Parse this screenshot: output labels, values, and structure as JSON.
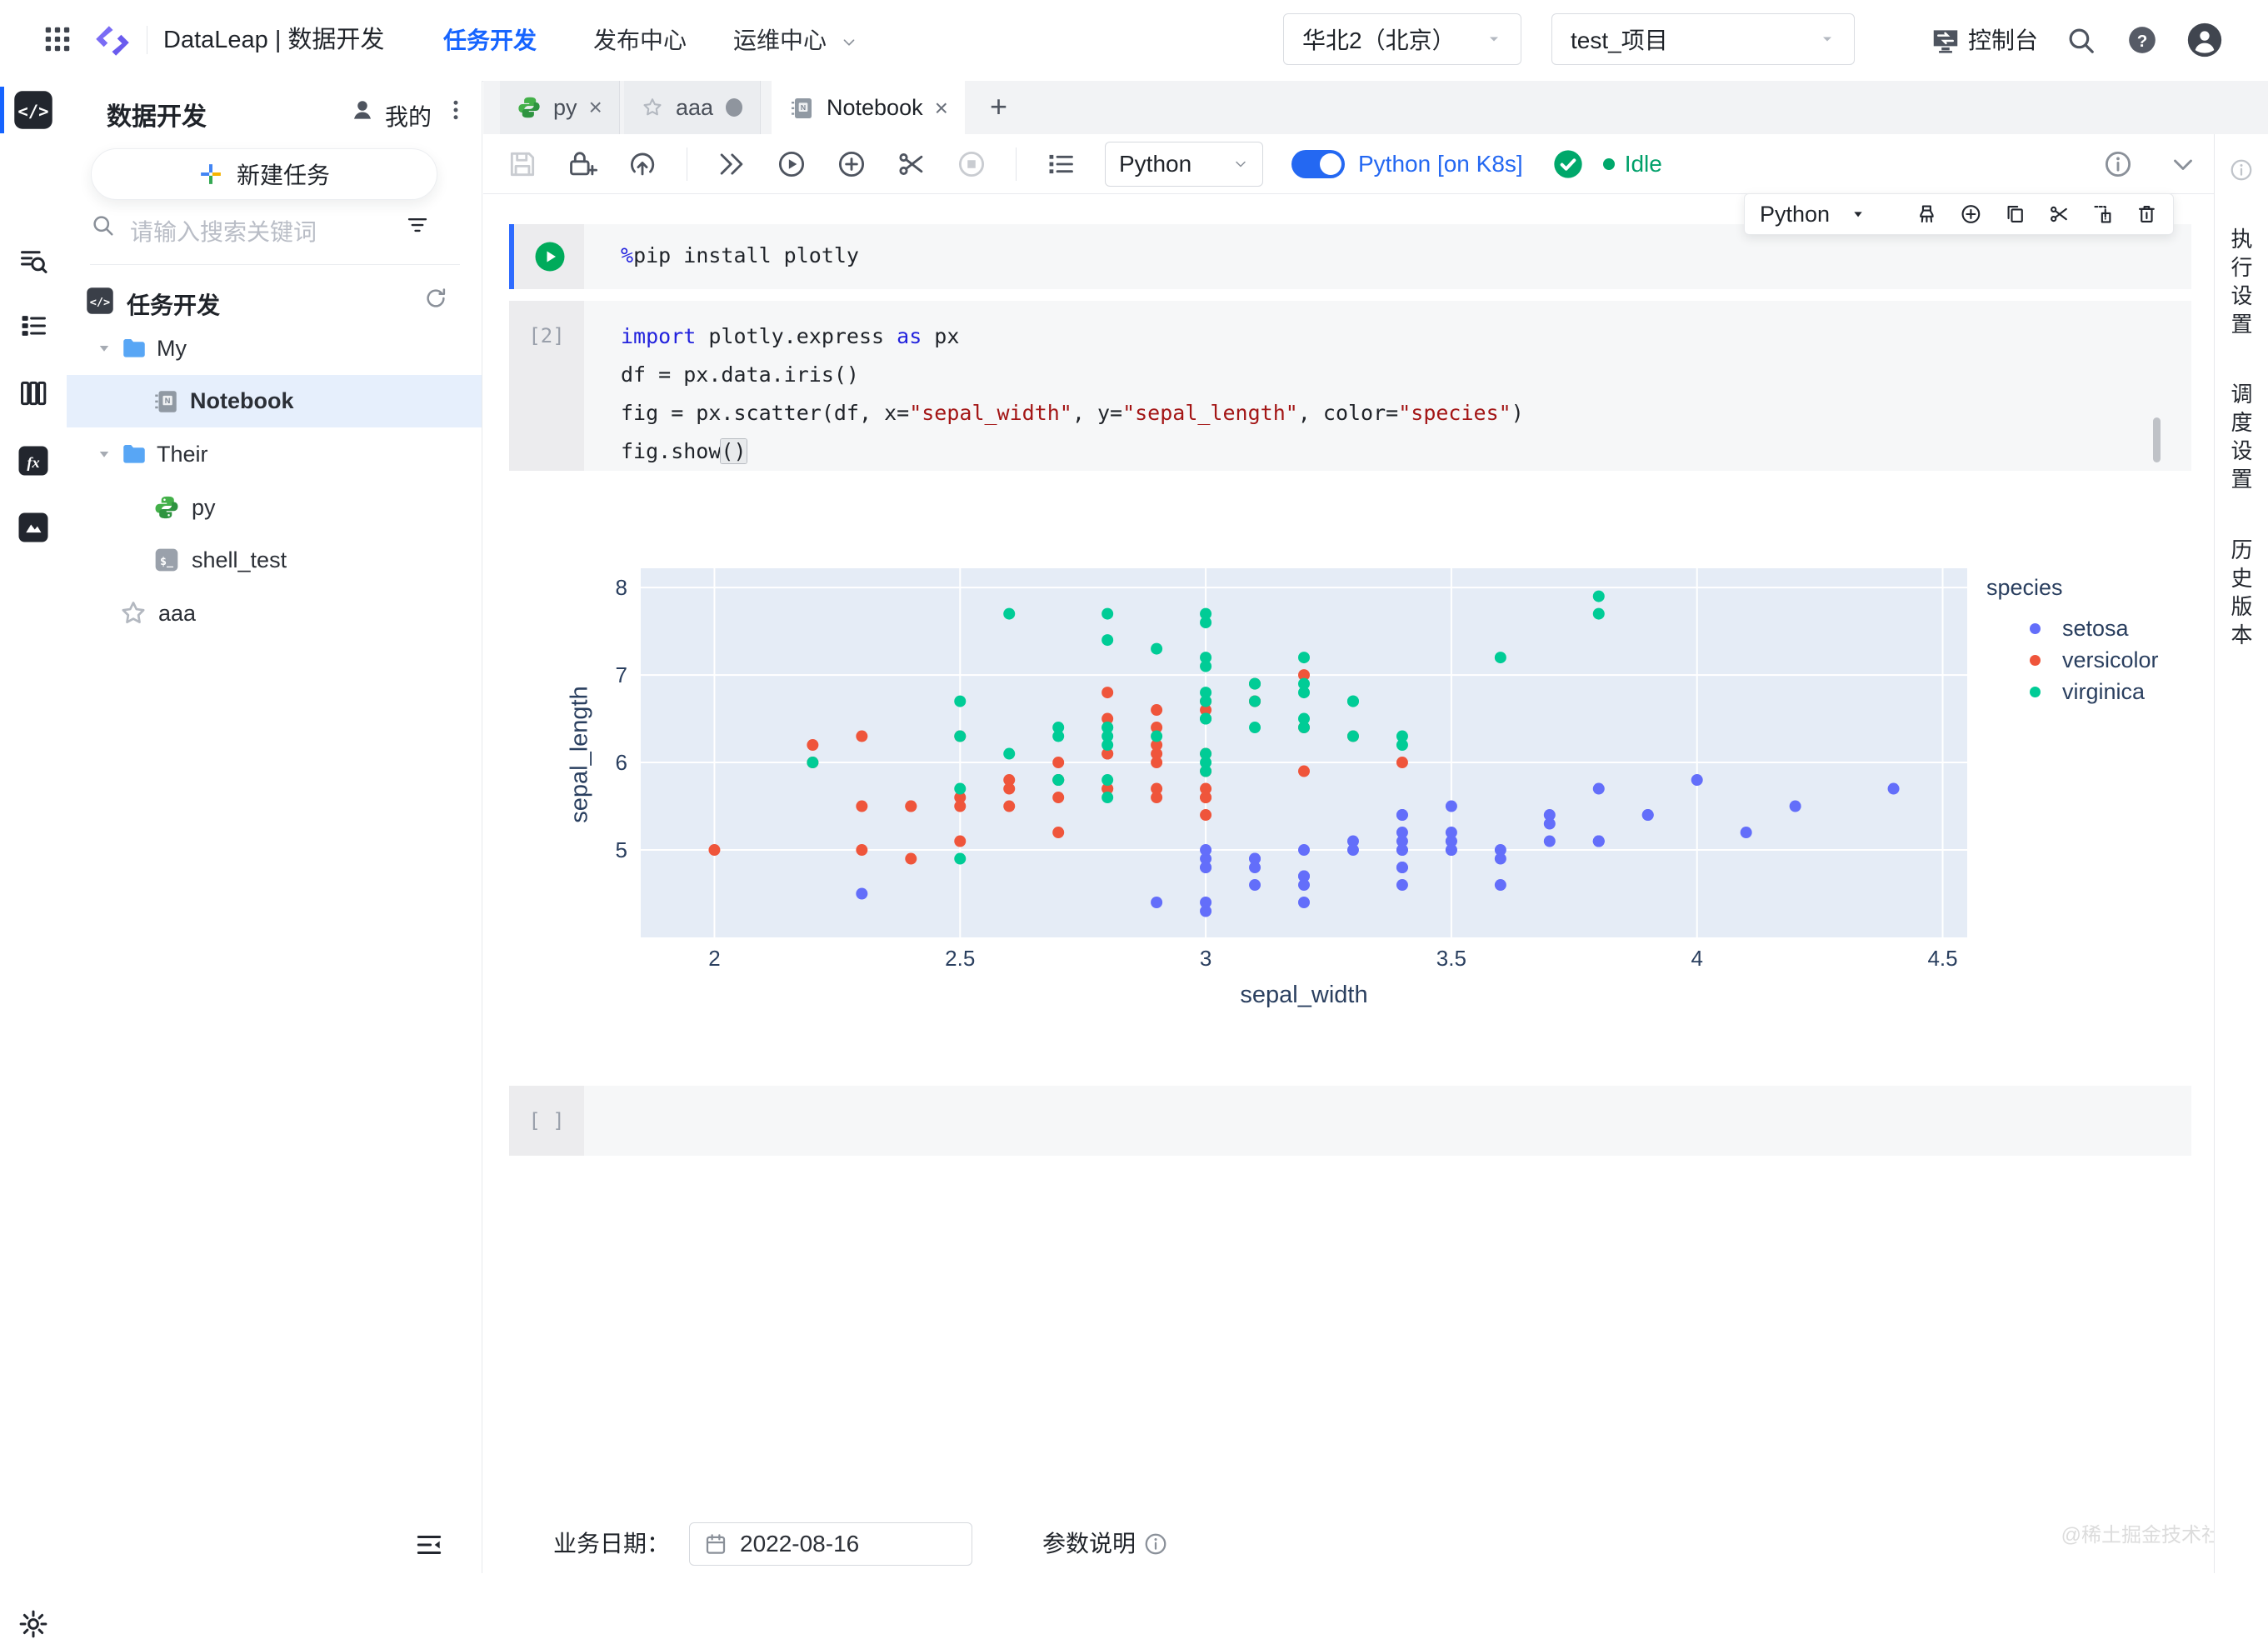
{
  "header": {
    "product_title": "DataLeap | 数据开发",
    "nav": [
      {
        "label": "任务开发",
        "active": true
      },
      {
        "label": "发布中心",
        "active": false
      },
      {
        "label": "运维中心",
        "active": false
      }
    ],
    "region_select": "华北2（北京）",
    "project_select": "test_项目",
    "console_label": "控制台",
    "icons": [
      "app-grid-icon",
      "dataleap-logo",
      "console-icon",
      "search-icon",
      "help-icon",
      "avatar"
    ]
  },
  "rail": {
    "items": [
      "code-editor",
      "data-search",
      "task-list",
      "data-catalog",
      "function-fx",
      "resource-library"
    ],
    "bottom": "settings-gear"
  },
  "sidebar": {
    "title": "数据开发",
    "mine_label": "我的",
    "new_task_label": "新建任务",
    "search_placeholder": "请输入搜索关键词",
    "tree_header": "任务开发",
    "tree": [
      {
        "label": "My",
        "type": "folder",
        "level": 1
      },
      {
        "label": "Notebook",
        "type": "notebook",
        "level": 2,
        "selected": true
      },
      {
        "label": "Their",
        "type": "folder",
        "level": 1
      },
      {
        "label": "py",
        "type": "python",
        "level": 2
      },
      {
        "label": "shell_test",
        "type": "shell",
        "level": 2
      },
      {
        "label": "aaa",
        "type": "starred",
        "level": 1
      }
    ]
  },
  "tabs": [
    {
      "label": "py",
      "icon": "python-icon",
      "close": "×",
      "dirty": false,
      "active": false
    },
    {
      "label": "aaa",
      "icon": "star-icon",
      "close": "",
      "dirty": true,
      "active": false
    },
    {
      "label": "Notebook",
      "icon": "notebook-icon",
      "close": "×",
      "dirty": false,
      "active": true
    }
  ],
  "new_tab_label": "+",
  "toolbar": {
    "icons": [
      "save",
      "lock-add",
      "submit",
      "run-all",
      "run-cell",
      "add-cell",
      "cut-cell",
      "interrupt",
      "outline"
    ],
    "kernel_select": "Python",
    "runtime_toggle_label": "Python [on K8s]",
    "kernel_ok": true,
    "status": "Idle",
    "right_icons": [
      "info",
      "chevron-down"
    ]
  },
  "cell_toolbar": {
    "kernel": "Python",
    "icons": [
      "clean",
      "add-cell",
      "duplicate",
      "cut",
      "paste",
      "delete"
    ]
  },
  "cells": {
    "cell1": {
      "lines": [
        [
          {
            "t": "%",
            "c": "kw"
          },
          {
            "t": "pip install plotly",
            "c": "pl"
          }
        ]
      ]
    },
    "cell2": {
      "exec": "[2]",
      "lines": [
        [
          {
            "t": "import",
            "c": "kw"
          },
          {
            "t": " plotly.express ",
            "c": "pl"
          },
          {
            "t": "as",
            "c": "kw"
          },
          {
            "t": " px",
            "c": "pl"
          }
        ],
        [
          {
            "t": "df = px.data.iris()",
            "c": "pl"
          }
        ],
        [
          {
            "t": "fig = px.scatter(df, x=",
            "c": "pl"
          },
          {
            "t": "\"sepal_width\"",
            "c": "str"
          },
          {
            "t": ", y=",
            "c": "pl"
          },
          {
            "t": "\"sepal_length\"",
            "c": "str"
          },
          {
            "t": ", color=",
            "c": "pl"
          },
          {
            "t": "\"species\"",
            "c": "str"
          },
          {
            "t": ")",
            "c": "pl"
          }
        ],
        [
          {
            "t": "fig.show",
            "c": "pl"
          },
          {
            "t": "()",
            "c": "br"
          }
        ]
      ]
    },
    "empty_cell": {
      "exec": "[ ]"
    }
  },
  "bottom_bar": {
    "date_label": "业务日期：",
    "date_value": "2022-08-16",
    "param_label": "参数说明"
  },
  "right_rail": [
    "执行设置",
    "调度设置",
    "历史版本"
  ],
  "watermark": "@稀土掘金技术社区",
  "colors": {
    "accent_blue": "#1664ff",
    "toggle_blue": "#2468f2",
    "status_green": "#00a86b",
    "plot_background": "#e5ecf6",
    "cell_play_green": "#00ab5b"
  },
  "chart_data": {
    "type": "scatter",
    "xlabel": "sepal_width",
    "ylabel": "sepal_length",
    "legend_title": "species",
    "legend_position": "right",
    "grid": "on",
    "plot_bg": "#e5ecf6",
    "xlim": [
      1.85,
      4.55
    ],
    "ylim": [
      4.0,
      8.22
    ],
    "xticks": [
      "2",
      "2.5",
      "3",
      "3.5",
      "4",
      "4.5"
    ],
    "xtick_values": [
      2,
      2.5,
      3,
      3.5,
      4,
      4.5
    ],
    "yticks": [
      "5",
      "6",
      "7",
      "8"
    ],
    "ytick_values": [
      5,
      6,
      7,
      8
    ],
    "marker_radius": 7,
    "series": [
      {
        "name": "setosa",
        "color": "#636efa",
        "x": [
          3.5,
          3.0,
          3.2,
          3.1,
          3.6,
          3.9,
          3.4,
          3.4,
          2.9,
          3.1,
          3.7,
          3.4,
          3.0,
          3.0,
          4.0,
          4.4,
          3.9,
          3.5,
          3.8,
          3.8,
          3.4,
          3.7,
          3.6,
          3.3,
          3.4,
          3.0,
          3.4,
          3.5,
          3.4,
          3.2,
          3.1,
          3.4,
          4.1,
          4.2,
          3.1,
          3.2,
          3.5,
          3.6,
          3.0,
          3.4,
          3.5,
          2.3,
          3.2,
          3.5,
          3.8,
          3.0,
          3.8,
          3.2,
          3.7,
          3.3
        ],
        "y": [
          5.1,
          4.9,
          4.7,
          4.6,
          5.0,
          5.4,
          4.6,
          5.0,
          4.4,
          4.9,
          5.4,
          4.8,
          4.8,
          4.3,
          5.8,
          5.7,
          5.4,
          5.1,
          5.7,
          5.1,
          5.4,
          5.1,
          4.6,
          5.1,
          4.8,
          5.0,
          5.0,
          5.2,
          5.2,
          4.7,
          4.8,
          5.4,
          5.2,
          5.5,
          4.9,
          5.0,
          5.5,
          4.9,
          4.4,
          5.1,
          5.0,
          4.5,
          4.4,
          5.0,
          5.1,
          4.8,
          5.1,
          4.6,
          5.3,
          5.0
        ]
      },
      {
        "name": "versicolor",
        "color": "#ef553b",
        "x": [
          3.2,
          3.2,
          3.1,
          2.3,
          2.8,
          2.8,
          3.3,
          2.4,
          2.9,
          2.7,
          2.0,
          3.0,
          2.2,
          2.9,
          2.9,
          3.1,
          3.0,
          2.7,
          2.2,
          2.5,
          3.2,
          2.8,
          2.5,
          2.8,
          2.9,
          3.0,
          2.8,
          3.0,
          2.9,
          2.6,
          2.4,
          2.4,
          2.7,
          2.7,
          3.0,
          3.4,
          3.1,
          2.3,
          3.0,
          2.5,
          2.6,
          3.0,
          2.6,
          2.3,
          2.7,
          3.0,
          2.9,
          2.9,
          2.5,
          2.8
        ],
        "y": [
          7.0,
          6.4,
          6.9,
          5.5,
          6.5,
          5.7,
          6.3,
          4.9,
          6.6,
          5.2,
          5.0,
          5.9,
          6.0,
          6.1,
          5.6,
          6.7,
          5.6,
          5.8,
          6.2,
          5.6,
          5.9,
          6.1,
          6.3,
          6.1,
          6.4,
          6.6,
          6.8,
          6.7,
          6.0,
          5.7,
          5.5,
          5.5,
          5.8,
          6.0,
          5.4,
          6.0,
          6.7,
          6.3,
          5.6,
          5.5,
          5.5,
          6.1,
          5.8,
          5.0,
          5.6,
          5.7,
          5.7,
          6.2,
          5.1,
          5.7
        ]
      },
      {
        "name": "virginica",
        "color": "#00cc96",
        "x": [
          3.3,
          2.7,
          3.0,
          2.9,
          3.0,
          3.0,
          2.5,
          2.9,
          2.5,
          3.6,
          3.2,
          2.7,
          3.0,
          2.5,
          2.8,
          3.2,
          3.0,
          3.8,
          2.6,
          2.2,
          3.2,
          2.8,
          2.8,
          2.7,
          3.3,
          3.2,
          2.8,
          3.0,
          2.8,
          3.0,
          2.8,
          3.8,
          2.8,
          2.8,
          2.6,
          3.0,
          3.4,
          3.1,
          3.0,
          3.1,
          3.1,
          3.1,
          2.7,
          3.2,
          3.3,
          3.0,
          2.5,
          3.0,
          3.4,
          3.0
        ],
        "y": [
          6.3,
          5.8,
          7.1,
          6.3,
          6.5,
          7.6,
          4.9,
          7.3,
          6.7,
          7.2,
          6.5,
          6.4,
          6.8,
          5.7,
          5.8,
          6.4,
          6.5,
          7.7,
          7.7,
          6.0,
          6.9,
          5.6,
          7.7,
          6.3,
          6.7,
          7.2,
          6.2,
          6.1,
          6.4,
          7.2,
          7.4,
          7.9,
          6.4,
          6.3,
          6.1,
          7.7,
          6.3,
          6.4,
          6.0,
          6.9,
          6.7,
          6.9,
          5.8,
          6.8,
          6.7,
          6.7,
          6.3,
          6.5,
          6.2,
          5.9
        ]
      }
    ]
  }
}
